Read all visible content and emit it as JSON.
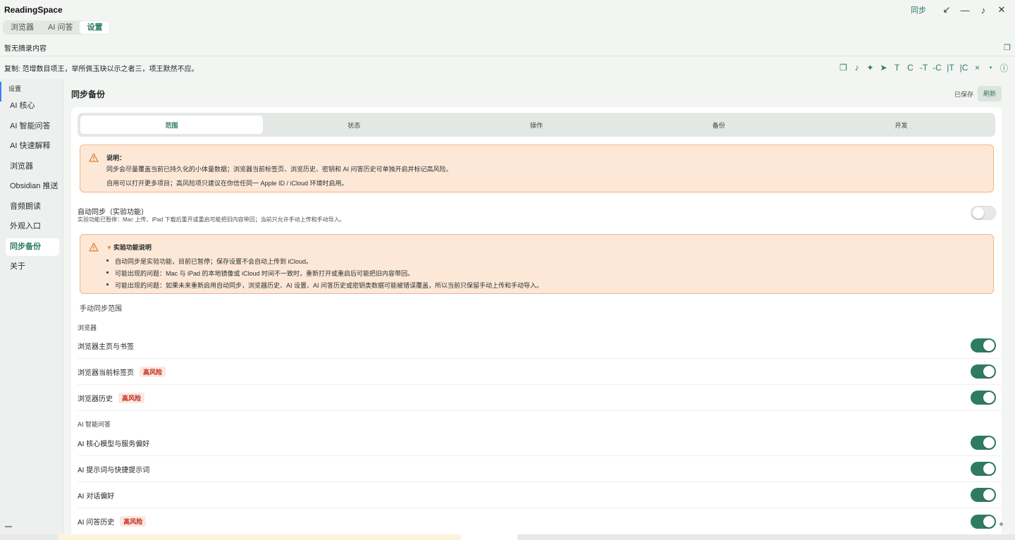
{
  "app": {
    "title": "ReadingSpace"
  },
  "window": {
    "sync_label": "同步",
    "restore_icon": "↙",
    "minimize_icon": "—",
    "music_icon": "♪",
    "close_icon": "✕"
  },
  "top_tabs": [
    {
      "label": "浏览器"
    },
    {
      "label": "AI 问答"
    },
    {
      "label": "设置"
    }
  ],
  "excerpt": {
    "text": "暂无摘录内容",
    "icon": "❐"
  },
  "copy_bar": {
    "text": "复制: 范增数目项王，举所佩玉玦以示之者三，项王默然不应。",
    "tools": [
      "❐",
      "♪",
      "✦",
      "➤",
      "T",
      "C",
      "-T",
      "-C",
      "|T",
      "|C",
      "×",
      "▾",
      "ⓘ"
    ]
  },
  "sidebar": {
    "heading": "设置",
    "items": [
      {
        "label": "AI 核心"
      },
      {
        "label": "AI 智能问答"
      },
      {
        "label": "AI 快速解释"
      },
      {
        "label": "浏览器"
      },
      {
        "label": "Obsidian 推送"
      },
      {
        "label": "音频朗读"
      },
      {
        "label": "外观入口"
      },
      {
        "label": "同步备份"
      },
      {
        "label": "关于"
      }
    ]
  },
  "main": {
    "title": "同步备份",
    "saved": "已保存",
    "refresh": "刷新",
    "seg_tabs": [
      "范围",
      "状态",
      "操作",
      "备份",
      "开发"
    ],
    "notice1": {
      "title": "说明：",
      "line1": "同步会尽量覆盖当前已持久化的小体量数据；浏览器当前标签页、浏览历史、密钥和 AI 问答历史可单独开启并标记高风险。",
      "line2": "自用可以打开更多项目；高风险项只建议在你信任同一 Apple ID / iCloud 环境时启用。"
    },
    "auto_sync": {
      "title": "自动同步（实验功能）",
      "desc": "实验功能已暂停：Mac 上传、iPad 下载后重开或重启可能把旧内容带回；当前只允许手动上传和手动导入。",
      "enabled": false
    },
    "notice2": {
      "title": "实验功能说明",
      "bullets": [
        "自动同步是实验功能，目前已暂停；保存设置不会自动上传到 iCloud。",
        "可能出现的问题：Mac 与 iPad 的本地镜像或 iCloud 时间不一致时，重新打开或重启后可能把旧内容带回。",
        "可能出现的问题：如果未来重新启用自动同步，浏览器历史、AI 设置、AI 问答历史或密钥类数据可能被错误覆盖，所以当前只保留手动上传和手动导入。"
      ]
    },
    "manual_heading": "手动同步范围",
    "risk_label": "高风险",
    "groups": [
      {
        "label": "浏览器",
        "items": [
          {
            "label": "浏览器主页与书签",
            "risk": false,
            "enabled": true
          },
          {
            "label": "浏览器当前标签页",
            "risk": true,
            "enabled": true
          },
          {
            "label": "浏览器历史",
            "risk": true,
            "enabled": true
          }
        ]
      },
      {
        "label": "AI 智能问答",
        "items": [
          {
            "label": "AI 核心模型与服务偏好",
            "risk": false,
            "enabled": true
          },
          {
            "label": "AI 提示词与快捷提示词",
            "risk": false,
            "enabled": true
          },
          {
            "label": "AI 对话偏好",
            "risk": false,
            "enabled": true
          },
          {
            "label": "AI 问答历史",
            "risk": true,
            "enabled": true
          }
        ]
      }
    ]
  }
}
